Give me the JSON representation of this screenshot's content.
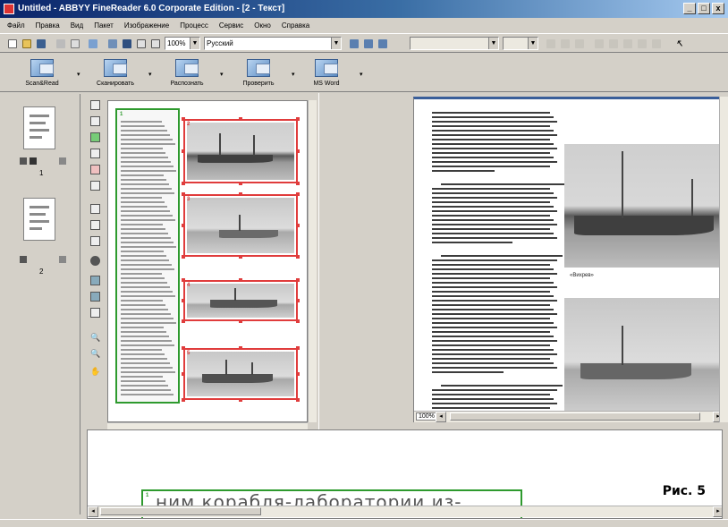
{
  "window": {
    "title": "Untitled - ABBYY FineReader 6.0 Corporate Edition - [2 - Текст]",
    "controls": [
      "_",
      "□",
      "x"
    ]
  },
  "menu": [
    "Файл",
    "Правка",
    "Вид",
    "Пакет",
    "Изображение",
    "Процесс",
    "Сервис",
    "Окно",
    "Справка"
  ],
  "toolbar": {
    "zoom": "100%",
    "language": "Русский"
  },
  "big_toolbar": [
    {
      "label": "Scan&Read"
    },
    {
      "label": "Сканировать"
    },
    {
      "label": "Распознать"
    },
    {
      "label": "Проверить"
    },
    {
      "label": "MS Word"
    }
  ],
  "thumbnails": [
    {
      "number": "1"
    },
    {
      "number": "2"
    }
  ],
  "image_regions": [
    {
      "label": "1",
      "kind": "text"
    },
    {
      "label": "2",
      "kind": "picture"
    },
    {
      "label": "3",
      "kind": "picture"
    },
    {
      "label": "4",
      "kind": "picture"
    },
    {
      "label": "5",
      "kind": "picture"
    }
  ],
  "text_pane": {
    "caption_1": "«Вихрев»",
    "zoom_badge": "100%"
  },
  "zoom_pane": {
    "region_label": "1",
    "text": "ним корабля-лаборатории из-"
  },
  "figure_label": "Рис. 5",
  "colors": {
    "title_bar": "#0a246a",
    "picture_region": "#e03c3c",
    "text_region": "#2e9a2e",
    "text_pane_header": "#3a5f9a"
  }
}
